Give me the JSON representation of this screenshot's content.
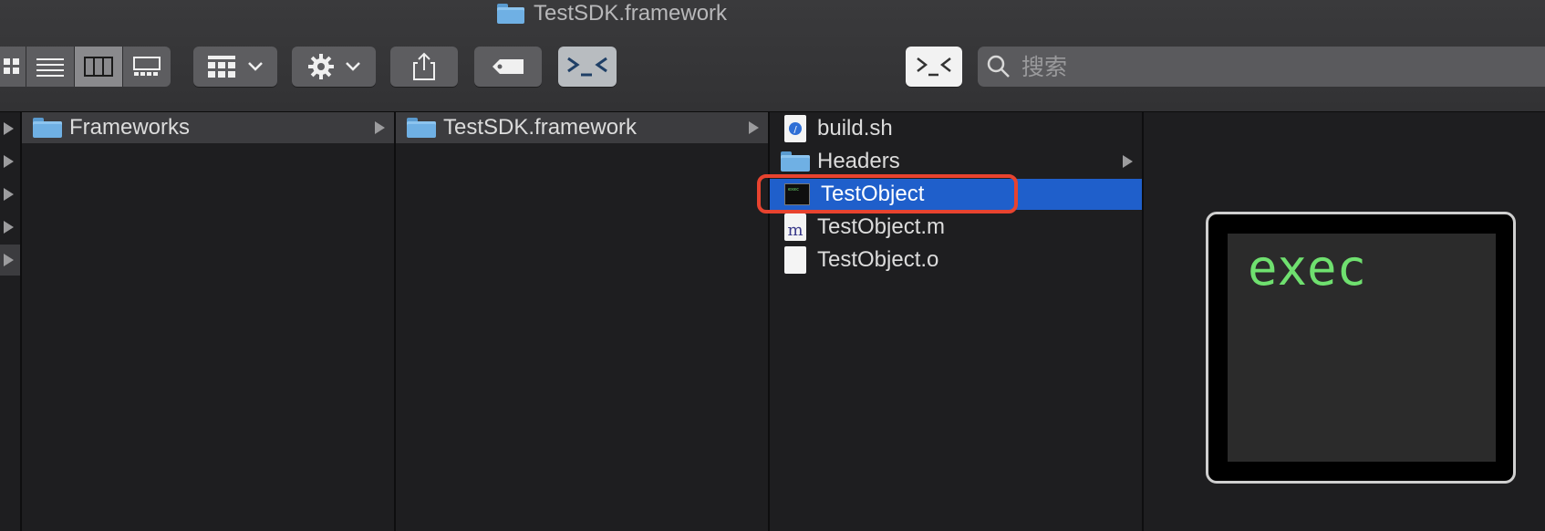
{
  "window": {
    "title": "TestSDK.framework"
  },
  "toolbar": {
    "view_icon_label": "icon-view",
    "search": {
      "placeholder": "搜索",
      "value": ""
    },
    "terminal_glyph": ">_<"
  },
  "columns": [
    {
      "items": [
        {
          "name": "Frameworks",
          "type": "folder",
          "highlighted": true,
          "has_children": true
        }
      ]
    },
    {
      "items": [
        {
          "name": "TestSDK.framework",
          "type": "folder",
          "highlighted": true,
          "has_children": true
        }
      ]
    },
    {
      "items": [
        {
          "name": "build.sh",
          "type": "script"
        },
        {
          "name": "Headers",
          "type": "folder",
          "has_children": true
        },
        {
          "name": "TestObject",
          "type": "exec",
          "selected": true
        },
        {
          "name": "TestObject.m",
          "type": "objc"
        },
        {
          "name": "TestObject.o",
          "type": "file"
        }
      ]
    }
  ],
  "preview": {
    "label": "exec"
  },
  "colors": {
    "selection": "#1f5fcb",
    "annotation": "#e8432f",
    "exec_text": "#6fe06f"
  }
}
